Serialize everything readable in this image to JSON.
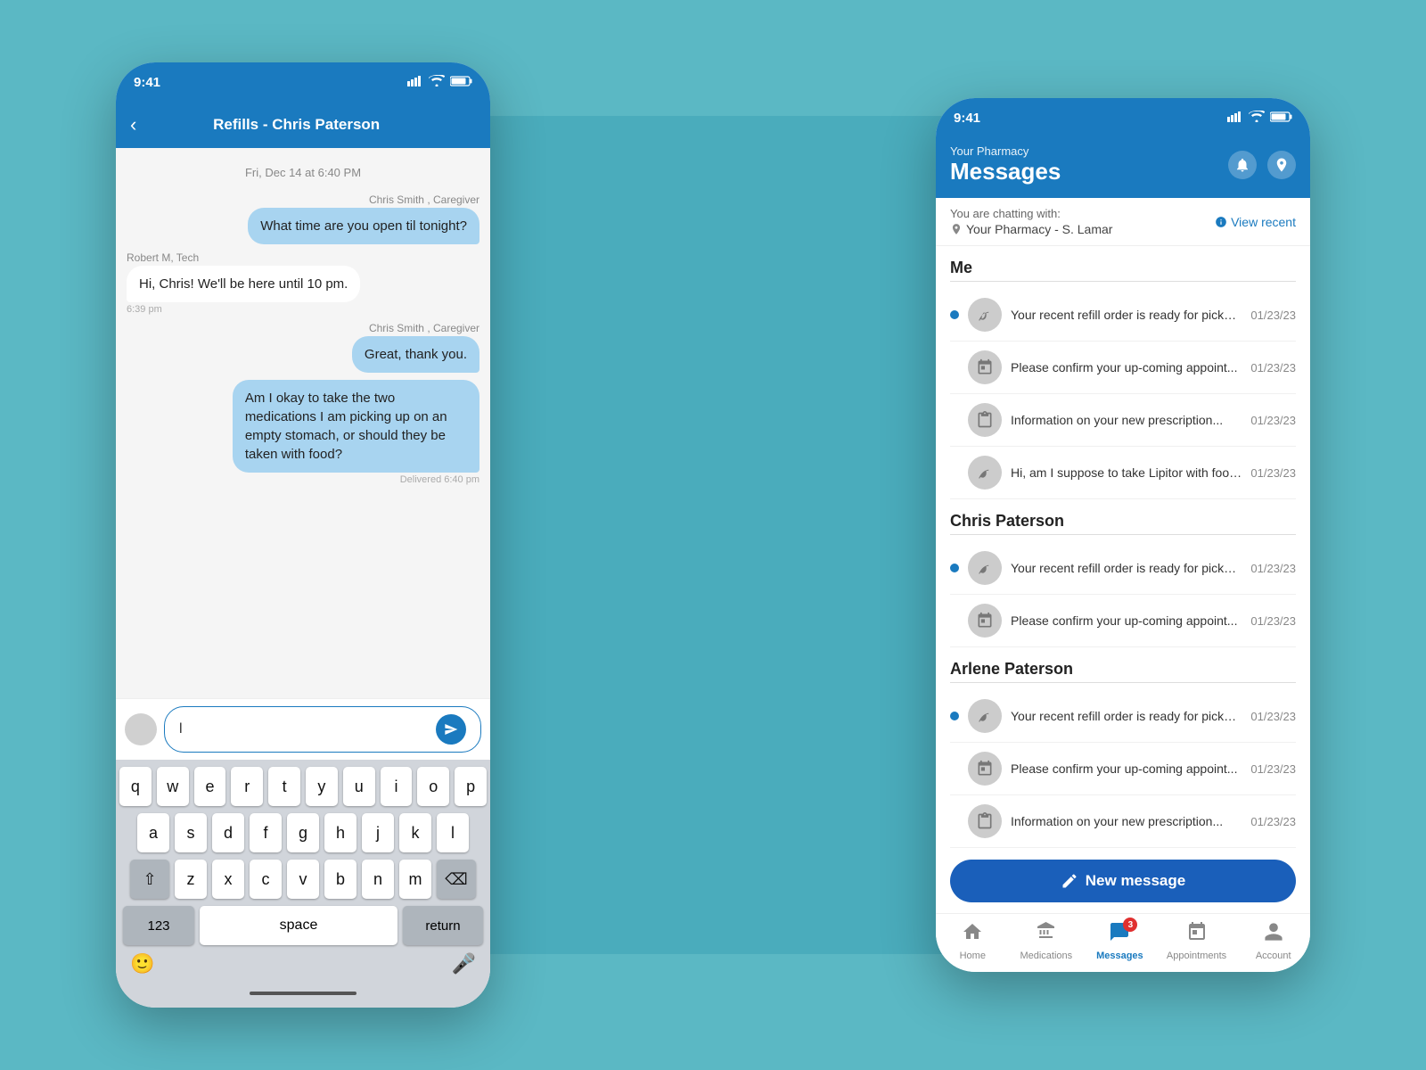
{
  "scene": {
    "bg_color": "#5bb8c4"
  },
  "left_phone": {
    "status_bar": {
      "time": "9:41",
      "signal": "▌▌▌▌",
      "wifi": "wifi",
      "battery": "battery"
    },
    "header": {
      "title": "Refills - Chris Paterson",
      "back": "‹"
    },
    "date_divider": "Fri, Dec 14 at 6:40 PM",
    "messages": [
      {
        "type": "outgoing",
        "sender": "Chris Smith , Caregiver",
        "text": "What time are you open til tonight?",
        "time": ""
      },
      {
        "type": "incoming",
        "sender": "Robert M, Tech",
        "text": "Hi, Chris! We'll be here until 10 pm.",
        "time": "6:39 pm"
      },
      {
        "type": "outgoing",
        "sender": "Chris Smith , Caregiver",
        "text": "Great, thank you.",
        "time": ""
      },
      {
        "type": "outgoing",
        "sender": "",
        "text": "Am I okay to take the two medications I am picking up on an empty stomach, or should they be taken with food?",
        "time": "Delivered 6:40 pm"
      }
    ],
    "input_placeholder": "l",
    "keyboard": {
      "row1": [
        "q",
        "w",
        "e",
        "r",
        "t",
        "y",
        "u",
        "i",
        "o",
        "p"
      ],
      "row2": [
        "a",
        "s",
        "d",
        "f",
        "g",
        "h",
        "j",
        "k",
        "l"
      ],
      "row3": [
        "z",
        "x",
        "c",
        "v",
        "b",
        "n",
        "m"
      ],
      "num_label": "123",
      "space_label": "space",
      "return_label": "return"
    }
  },
  "right_phone": {
    "status_bar": {
      "time": "9:41"
    },
    "header": {
      "pharmacy_label": "Your Pharmacy",
      "title": "Messages",
      "bell_icon": "🔔",
      "location_icon": "📍"
    },
    "chat_with": {
      "label": "You are chatting with:",
      "pharmacy": "Your Pharmacy - S. Lamar",
      "view_recent": "View recent"
    },
    "sections": [
      {
        "name": "Me",
        "messages": [
          {
            "dot": true,
            "icon": "refill",
            "text": "Your recent refill order is ready for pickup...",
            "date": "01/23/23"
          },
          {
            "dot": false,
            "icon": "calendar",
            "text": "Please confirm your up-coming appoint...",
            "date": "01/23/23"
          },
          {
            "dot": false,
            "icon": "clipboard",
            "text": "Information on your new prescription...",
            "date": "01/23/23"
          },
          {
            "dot": false,
            "icon": "refill",
            "text": "Hi, am I suppose to take Lipitor with food?",
            "date": "01/23/23"
          }
        ]
      },
      {
        "name": "Chris Paterson",
        "messages": [
          {
            "dot": true,
            "icon": "refill",
            "text": "Your recent refill order is ready for pickup...",
            "date": "01/23/23"
          },
          {
            "dot": false,
            "icon": "calendar",
            "text": "Please confirm your up-coming appoint...",
            "date": "01/23/23"
          }
        ]
      },
      {
        "name": "Arlene Paterson",
        "messages": [
          {
            "dot": true,
            "icon": "refill",
            "text": "Your recent refill order is ready for pickup...",
            "date": "01/23/23"
          },
          {
            "dot": false,
            "icon": "calendar",
            "text": "Please confirm your up-coming appoint...",
            "date": "01/23/23"
          },
          {
            "dot": false,
            "icon": "clipboard",
            "text": "Information on your new prescription...",
            "date": "01/23/23"
          }
        ]
      }
    ],
    "new_message_btn": "New message",
    "bottom_nav": [
      {
        "label": "Home",
        "icon": "🏠",
        "active": false,
        "badge": 0
      },
      {
        "label": "Medications",
        "icon": "💊",
        "active": false,
        "badge": 0
      },
      {
        "label": "Messages",
        "icon": "💬",
        "active": true,
        "badge": 3
      },
      {
        "label": "Appointments",
        "icon": "📅",
        "active": false,
        "badge": 0
      },
      {
        "label": "Account",
        "icon": "👤",
        "active": false,
        "badge": 0
      }
    ]
  }
}
